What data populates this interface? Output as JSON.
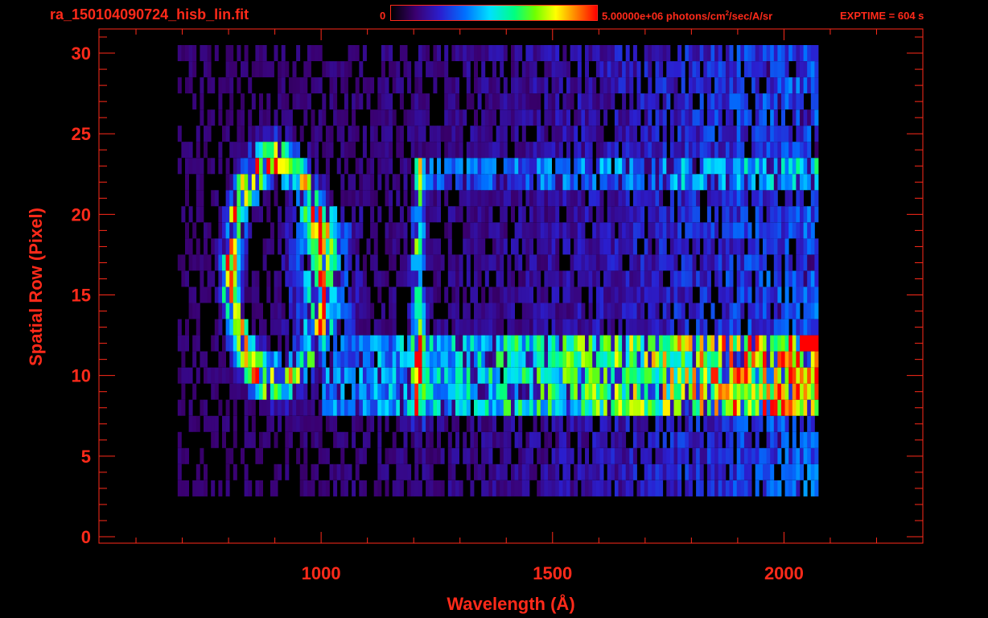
{
  "header": {
    "filename": "ra_150104090724_hisb_lin.fit",
    "colorbar_min": "0",
    "colorbar_max_prefix": "5.00000e+06 photons/cm",
    "colorbar_max_sup": "2",
    "colorbar_max_suffix": "/sec/A/sr",
    "exptime": "EXPTIME = 604 s"
  },
  "colors": {
    "axis": "#ff2a1a",
    "background": "#000000",
    "colormap": [
      "#000000",
      "#3a0070",
      "#2a1fd0",
      "#0070ff",
      "#00e0ff",
      "#00ff80",
      "#70ff00",
      "#ffff00",
      "#ff8000",
      "#ff0000"
    ]
  },
  "chart_data": {
    "type": "heatmap",
    "title": "ra_150104090724_hisb_lin.fit",
    "xlabel": "Wavelength (Å)",
    "ylabel": "Spatial Row (Pixel)",
    "xlim": [
      520,
      2300
    ],
    "ylim": [
      -0.4,
      31.5
    ],
    "x_ticks": [
      1000,
      1500,
      2000
    ],
    "x_minor_step": 100,
    "y_ticks": [
      0,
      5,
      10,
      15,
      20,
      25,
      30
    ],
    "y_minor_step": 1,
    "value_range": [
      0,
      5000000
    ],
    "value_unit": "photons/cm2/sec/A/sr",
    "data_extent_x": [
      690,
      2070
    ],
    "data_rows": [
      3,
      30
    ],
    "features": [
      {
        "center_x": 905,
        "center_y": 16.5,
        "rx": 100,
        "ry": 6.8,
        "peak": 0.9,
        "shape": "ring"
      },
      {
        "center_x": 1210,
        "rows": [
          7,
          23
        ],
        "peak": 0.55,
        "shape": "vertical-line"
      },
      {
        "x_range": [
          1000,
          2070
        ],
        "rows": [
          8,
          12
        ],
        "peak_x": 2050,
        "peak": 0.72,
        "shape": "horizontal-band"
      },
      {
        "x_range": [
          1200,
          2070
        ],
        "rows": [
          22,
          23
        ],
        "peak": 0.4,
        "shape": "horizontal-band"
      }
    ]
  }
}
